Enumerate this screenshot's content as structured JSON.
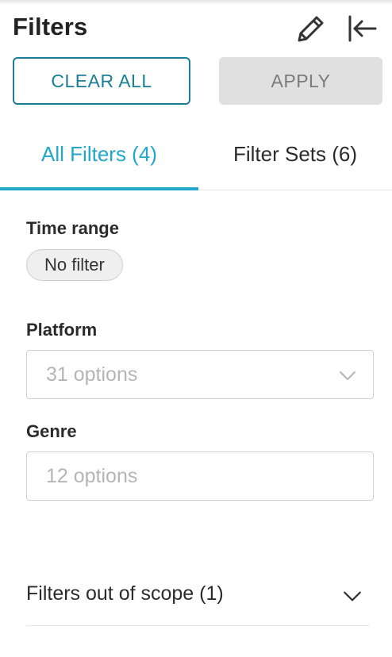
{
  "header": {
    "title": "Filters",
    "edit_icon": "pencil-icon",
    "collapse_icon": "collapse-left-icon"
  },
  "actions": {
    "clear_all_label": "CLEAR ALL",
    "apply_label": "APPLY"
  },
  "tabs": [
    {
      "label": "All Filters (4)",
      "active": true
    },
    {
      "label": "Filter Sets (6)",
      "active": false
    }
  ],
  "filters": {
    "time_range": {
      "label": "Time range",
      "value": "No filter"
    },
    "platform": {
      "label": "Platform",
      "placeholder": "31 options"
    },
    "genre": {
      "label": "Genre",
      "placeholder": "12 options"
    }
  },
  "out_of_scope": {
    "label": "Filters out of scope (1)"
  },
  "colors": {
    "accent": "#20a7c9",
    "clear_border": "#1c7d96",
    "apply_bg": "#e0e0e0"
  }
}
